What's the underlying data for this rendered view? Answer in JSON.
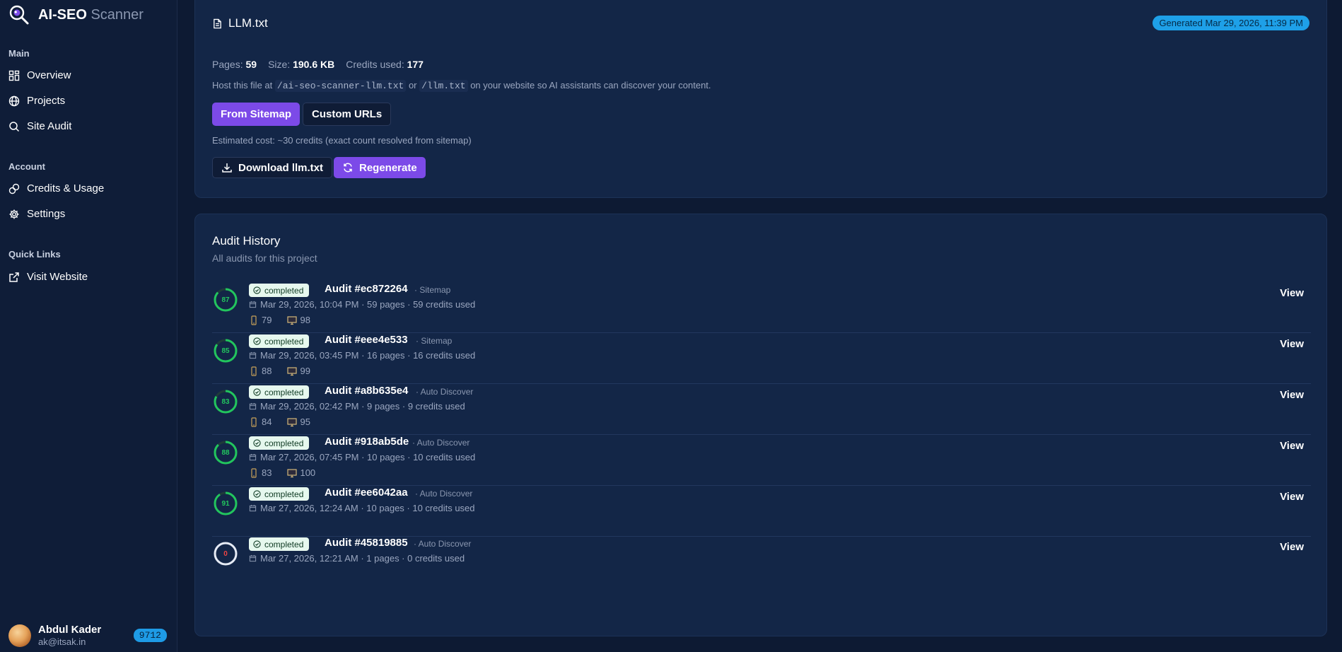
{
  "app": {
    "brand": "AI-SEO",
    "brand_suffix": "Scanner"
  },
  "sidebar": {
    "sections": [
      {
        "title": "Main",
        "items": [
          {
            "label": "Overview",
            "icon": "grid-icon"
          },
          {
            "label": "Projects",
            "icon": "globe-icon"
          },
          {
            "label": "Site Audit",
            "icon": "search-icon"
          }
        ]
      },
      {
        "title": "Account",
        "items": [
          {
            "label": "Credits & Usage",
            "icon": "coins-icon"
          },
          {
            "label": "Settings",
            "icon": "gear-icon"
          }
        ]
      },
      {
        "title": "Quick Links",
        "items": [
          {
            "label": "Visit Website",
            "icon": "external-link-icon"
          }
        ]
      }
    ],
    "user": {
      "name": "Abdul Kader",
      "email": "ak@itsak.in",
      "credits": "9712"
    }
  },
  "llm": {
    "title": "LLM.txt",
    "generated": "Generated Mar 29, 2026, 11:39 PM",
    "pages_label": "Pages:",
    "pages": "59",
    "size_label": "Size:",
    "size": "190.6 KB",
    "credits_label": "Credits used:",
    "credits": "177",
    "host_prefix": "Host this file at",
    "host_path1": "/ai-seo-scanner-llm.txt",
    "host_or": "or",
    "host_path2": "/llm.txt",
    "host_suffix": "on your website so AI assistants can discover your content.",
    "from_sitemap": "From Sitemap",
    "custom_urls": "Custom URLs",
    "estimated": "Estimated cost: ~30 credits (exact count resolved from sitemap)",
    "download": "Download llm.txt",
    "regenerate": "Regenerate"
  },
  "audit_history": {
    "title": "Audit History",
    "subtitle": "All audits for this project",
    "view_label": "View",
    "status_label": "completed",
    "rows": [
      {
        "score": 87,
        "name": "Audit #ec872264",
        "source": "· Sitemap",
        "meta": "Mar 29, 2026, 10:04 PM · 59 pages · 59 credits used",
        "mobile": "79",
        "desktop": "98"
      },
      {
        "score": 85,
        "name": "Audit #eee4e533",
        "source": "· Sitemap",
        "meta": "Mar 29, 2026, 03:45 PM · 16 pages · 16 credits used",
        "mobile": "88",
        "desktop": "99"
      },
      {
        "score": 83,
        "name": "Audit #a8b635e4",
        "source": "· Auto Discover",
        "meta": "Mar 29, 2026, 02:42 PM · 9 pages · 9 credits used",
        "mobile": "84",
        "desktop": "95"
      },
      {
        "score": 88,
        "name": "Audit #918ab5de",
        "source": "· Auto Discover",
        "meta": "Mar 27, 2026, 07:45 PM · 10 pages · 10 credits used",
        "mobile": "83",
        "desktop": "100"
      },
      {
        "score": 91,
        "name": "Audit #ee6042aa",
        "source": "· Auto Discover",
        "meta": "Mar 27, 2026, 12:24 AM · 10 pages · 10 credits used"
      },
      {
        "score": 0,
        "name": "Audit #45819885",
        "source": "· Auto Discover",
        "meta": "Mar 27, 2026, 12:21 AM · 1 pages · 0 credits used"
      }
    ]
  },
  "colors": {
    "accent": "#7c4ae8",
    "badge": "#1ea0e8",
    "good": "#22c55e",
    "bad": "#ef4444"
  }
}
